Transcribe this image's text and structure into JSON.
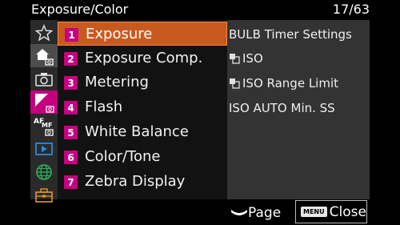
{
  "header": {
    "title": "Exposure/Color",
    "page_indicator": "17/63"
  },
  "tabs": [
    {
      "icon": "star-icon"
    },
    {
      "icon": "home-camera-icon"
    },
    {
      "icon": "camera-icon"
    },
    {
      "icon": "exposure-color-icon"
    },
    {
      "icon": "af-mf-icon",
      "text": "AF",
      "subtext": "MF"
    },
    {
      "icon": "playback-icon"
    },
    {
      "icon": "network-icon"
    },
    {
      "icon": "toolbox-icon"
    }
  ],
  "menu": {
    "items": [
      {
        "number": "1",
        "label": "Exposure",
        "active": true
      },
      {
        "number": "2",
        "label": "Exposure Comp."
      },
      {
        "number": "3",
        "label": "Metering"
      },
      {
        "number": "4",
        "label": "Flash"
      },
      {
        "number": "5",
        "label": "White Balance"
      },
      {
        "number": "6",
        "label": "Color/Tone"
      },
      {
        "number": "7",
        "label": "Zebra Display"
      }
    ]
  },
  "submenu": {
    "items": [
      {
        "label": "BULB Timer Settings"
      },
      {
        "label": "ISO",
        "icon": "video-photo-icon"
      },
      {
        "label": "ISO Range Limit",
        "icon": "video-photo-icon"
      },
      {
        "label": "ISO AUTO Min. SS"
      }
    ]
  },
  "footer": {
    "page_label": "Page",
    "menu_icon_text": "MENU",
    "close_label": "Close"
  },
  "colors": {
    "accent": "#c95a1f",
    "number_badge": "#c80080",
    "selected_tab": "#c2007d"
  }
}
